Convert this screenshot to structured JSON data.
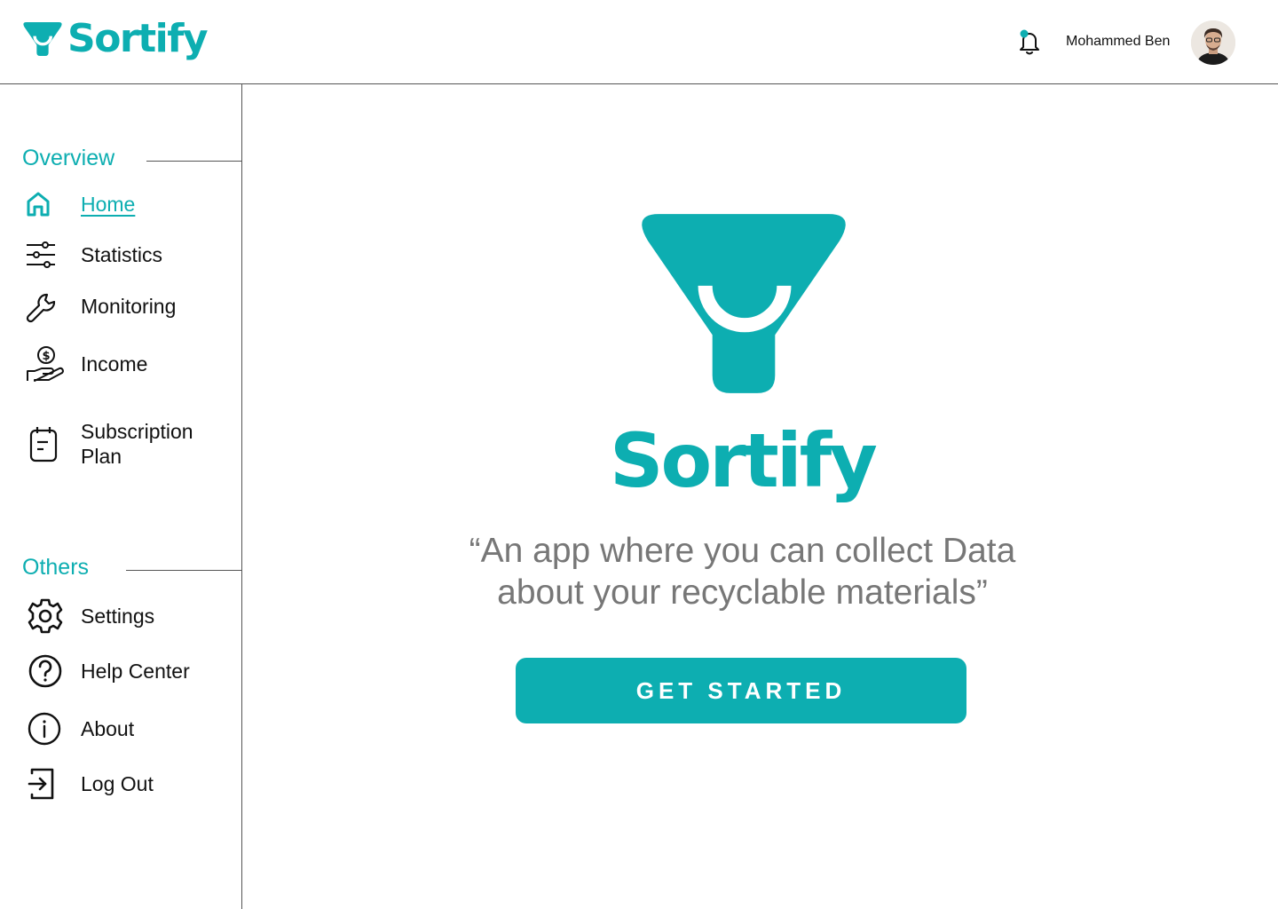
{
  "colors": {
    "brand": "#0daeb1",
    "text": "#111111",
    "muted": "#777777",
    "divider": "#555555",
    "background": "#ffffff"
  },
  "header": {
    "brand_name": "Sortify",
    "user_name": "Mohammed Ben",
    "icons": [
      "sortify-funnel-logo-icon",
      "bell-icon",
      "avatar"
    ]
  },
  "sidebar": {
    "overview_heading": "Overview",
    "others_heading": "Others",
    "overview_items": [
      {
        "label": "Home",
        "icon": "home-icon",
        "active": true
      },
      {
        "label": "Statistics",
        "icon": "sliders-icon",
        "active": false
      },
      {
        "label": "Monitoring",
        "icon": "wrench-icon",
        "active": false
      },
      {
        "label": "Income",
        "icon": "hand-coin-icon",
        "active": false
      },
      {
        "label": "Subscription\nPlan",
        "icon": "document-calendar-icon",
        "active": false
      }
    ],
    "others_items": [
      {
        "label": "Settings",
        "icon": "gear-icon"
      },
      {
        "label": "Help Center",
        "icon": "question-circle-icon"
      },
      {
        "label": "About",
        "icon": "info-circle-icon"
      },
      {
        "label": "Log Out",
        "icon": "logout-icon"
      }
    ]
  },
  "main": {
    "title": "Sortify",
    "tagline_line1": "“An app where you can collect Data",
    "tagline_line2": "about your recyclable materials”",
    "cta_label": "GET STARTED"
  }
}
